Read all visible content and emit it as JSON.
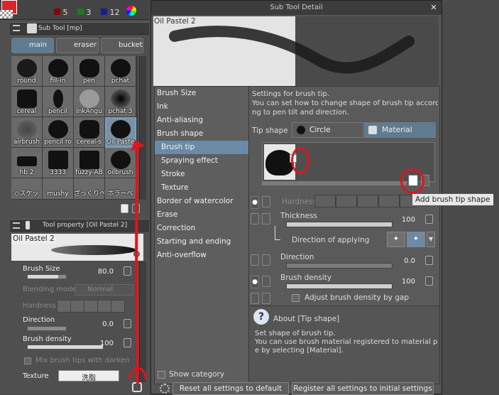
{
  "palette": {
    "counts": [
      "5",
      "3",
      "12"
    ],
    "colors": [
      "#7d0b0b",
      "#1b7a1b",
      "#1b1b8c"
    ]
  },
  "subtool_panel": {
    "header": "Sub Tool [mp]",
    "tabs": [
      {
        "label": "main"
      },
      {
        "label": "eraser"
      },
      {
        "label": "bucket"
      }
    ],
    "brushes": [
      {
        "label": "round"
      },
      {
        "label": "fill-in"
      },
      {
        "label": "pen"
      },
      {
        "label": "pchat"
      },
      {
        "label": "cereal"
      },
      {
        "label": "pencil"
      },
      {
        "label": "InkAngu"
      },
      {
        "label": "pchat 3"
      },
      {
        "label": "airbrush"
      },
      {
        "label": "pencil ro"
      },
      {
        "label": "cereal-s"
      },
      {
        "label": "Oil Paste"
      },
      {
        "label": "hb 2"
      },
      {
        "label": "3333"
      },
      {
        "label": "fuzzy-AB"
      },
      {
        "label": "oilbrush"
      },
      {
        "label": "◇スケッ"
      },
      {
        "label": "mushy"
      },
      {
        "label": "ざっくりペ"
      },
      {
        "label": "ホラーベ"
      }
    ]
  },
  "tool_property": {
    "header": "Tool property [Oil Pastel 2]",
    "name": "Oil Pastel 2",
    "brush_size": {
      "label": "Brush Size",
      "value": "80.0",
      "level": 0.8
    },
    "blending_mode": {
      "label": "Blending mode",
      "value": "Normal"
    },
    "hardness": {
      "label": "Hardness"
    },
    "direction": {
      "label": "Direction",
      "value": "0.0",
      "level": 0
    },
    "brush_density": {
      "label": "Brush density",
      "value": "100",
      "level": 1.0
    },
    "mix_brush_tips": {
      "label": "Mix brush tips with darken"
    },
    "texture": {
      "label": "Texture",
      "value": "洗脂"
    }
  },
  "dialog": {
    "title": "Sub Tool Detail",
    "preview_label": "Oil Pastel 2",
    "nav_items": [
      {
        "label": "Brush Size"
      },
      {
        "label": "Ink"
      },
      {
        "label": "Anti-aliasing"
      },
      {
        "label": "Brush shape"
      },
      {
        "label": "Brush tip"
      },
      {
        "label": "Spraying effect"
      },
      {
        "label": "Stroke"
      },
      {
        "label": "Texture"
      },
      {
        "label": "Border of watercolor"
      },
      {
        "label": "Erase"
      },
      {
        "label": "Correction"
      },
      {
        "label": "Starting and ending"
      },
      {
        "label": "Anti-overflow"
      }
    ],
    "description_lines": [
      "Settings for brush tip.",
      "You can set how to change shape of brush tip accord",
      "ng to pen tilt and direction."
    ],
    "tip_shape_label": "Tip shape",
    "tip_shape_options": [
      {
        "label": "Circle"
      },
      {
        "label": "Material"
      }
    ],
    "tooltip": "Add brush tip shape",
    "hardness_label": "Hardness",
    "thickness": {
      "label": "Thickness",
      "value": "100",
      "level": 1.0
    },
    "direction_of_applying": {
      "label": "Direction of applying"
    },
    "direction": {
      "label": "Direction",
      "value": "0.0",
      "level": 0
    },
    "brush_density": {
      "label": "Brush density",
      "value": "100",
      "level": 1.0
    },
    "adjust_density": {
      "label": "Adjust brush density by gap"
    },
    "about": {
      "title": "About [Tip shape]",
      "lines": [
        "Set shape of brush tip.",
        "You can use brush material registered to material palett",
        "e by selecting [Material]."
      ]
    },
    "show_category": "Show category",
    "reset_button": "Reset all settings to default",
    "register_button": "Register all settings to initial settings"
  }
}
